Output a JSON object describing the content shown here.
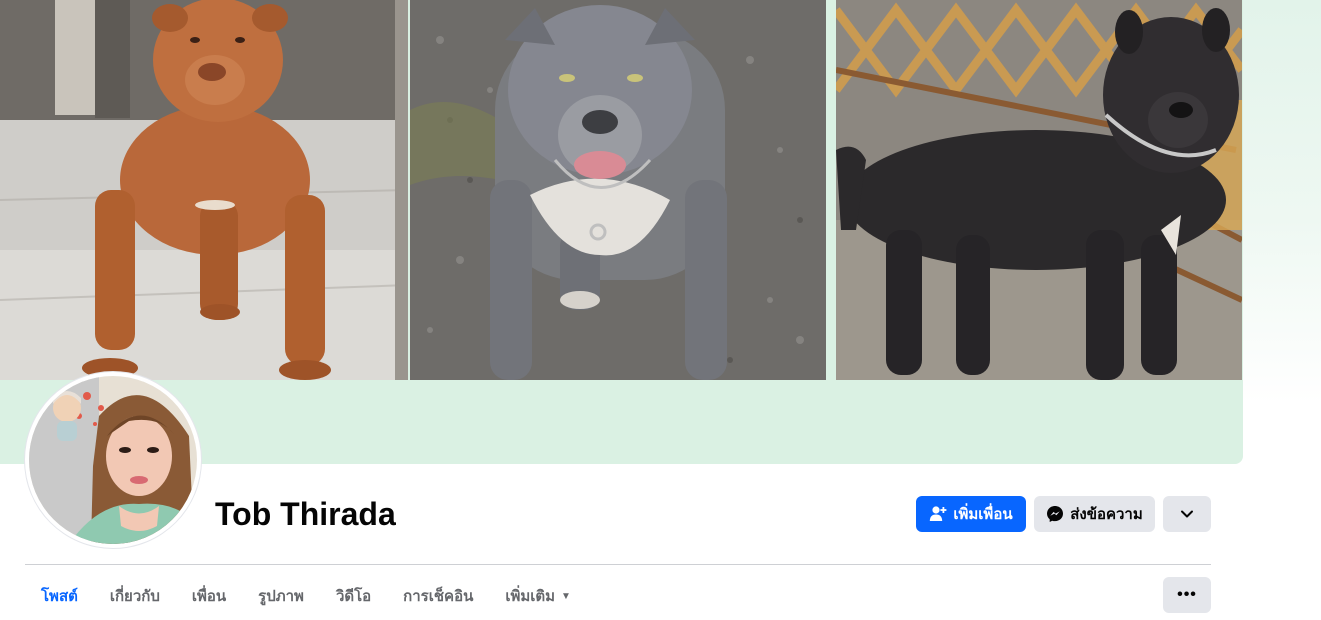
{
  "profile": {
    "name": "Tob Thirada"
  },
  "actions": {
    "add_friend_label": "เพิ่มเพื่อน",
    "message_label": "ส่งข้อความ"
  },
  "tabs": [
    {
      "label": "โพสต์",
      "active": true
    },
    {
      "label": "เกี่ยวกับ",
      "active": false
    },
    {
      "label": "เพื่อน",
      "active": false
    },
    {
      "label": "รูปภาพ",
      "active": false
    },
    {
      "label": "วิดีโอ",
      "active": false
    },
    {
      "label": "การเช็คอิน",
      "active": false
    },
    {
      "label": "เพิ่มเติม",
      "active": false
    }
  ],
  "colors": {
    "accent": "#0866ff",
    "cover_bg": "#daf1e3",
    "button_gray": "#e4e6eb"
  },
  "icons": {
    "add_friend": "person-plus-icon",
    "message": "messenger-icon",
    "more": "chevron-down-icon",
    "tab_more": "ellipsis-icon",
    "dropdown": "caret-down-icon"
  }
}
